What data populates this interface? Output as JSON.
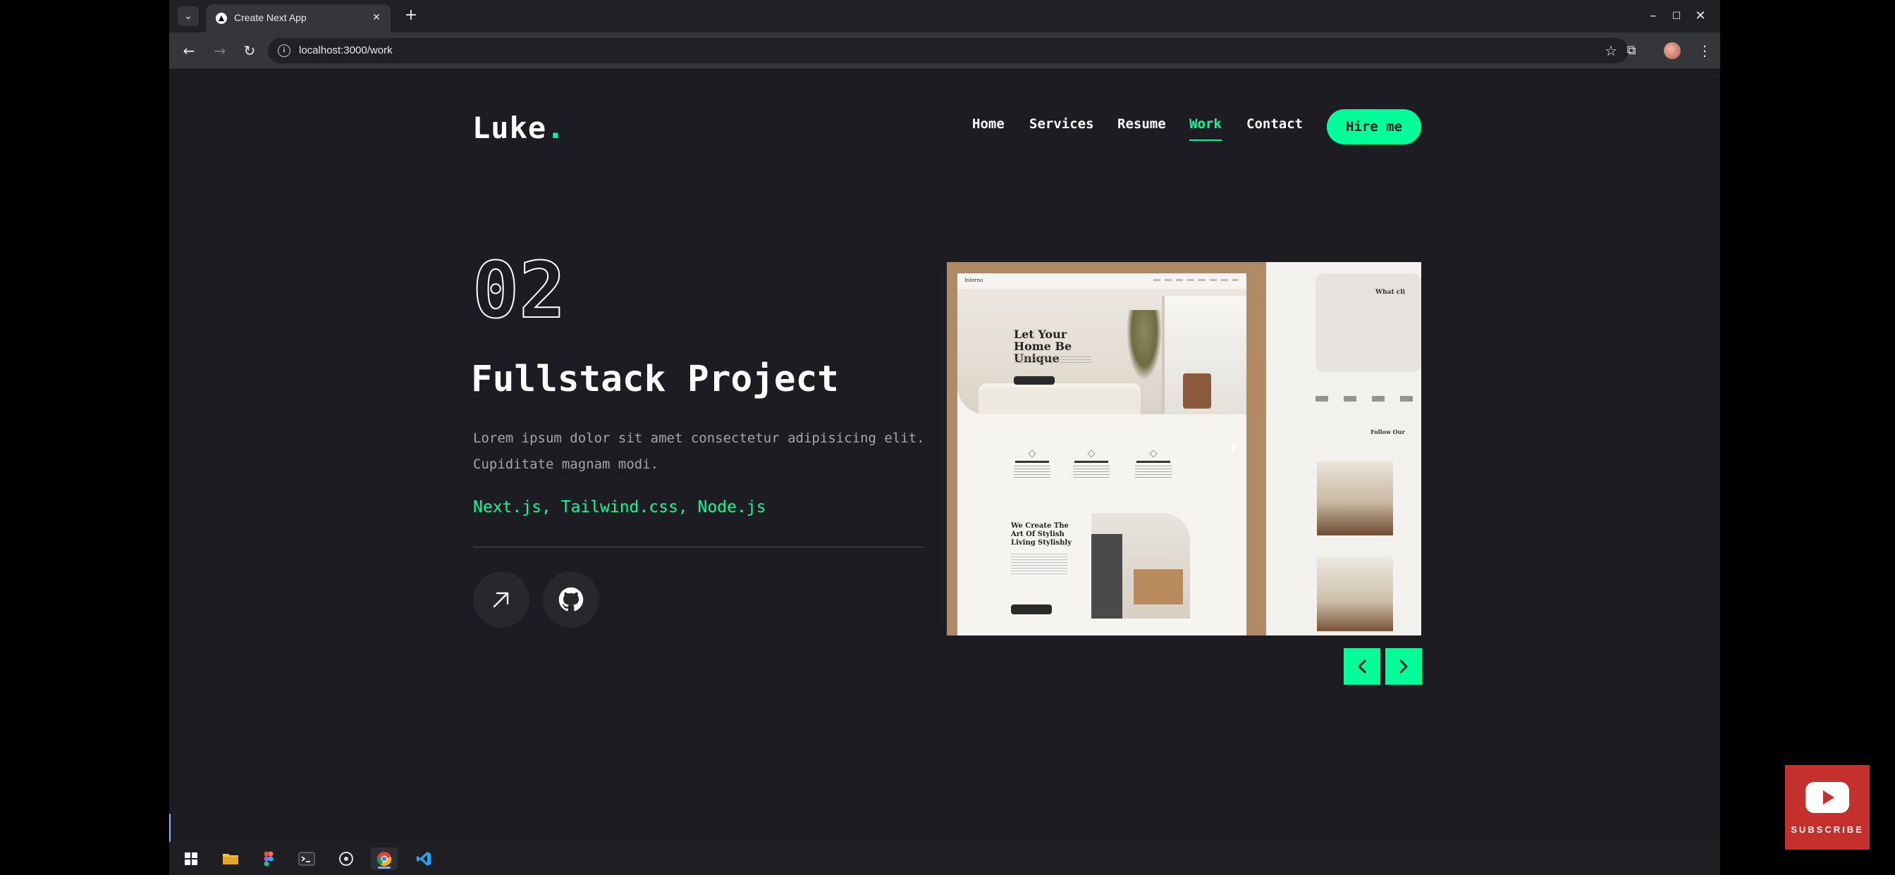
{
  "browser": {
    "tab_title": "Create Next App",
    "url": "localhost:3000/work"
  },
  "site": {
    "logo_text": "Luke",
    "logo_dot": ".",
    "nav": [
      {
        "label": "Home",
        "active": false
      },
      {
        "label": "Services",
        "active": false
      },
      {
        "label": "Resume",
        "active": false
      },
      {
        "label": "Work",
        "active": true
      },
      {
        "label": "Contact",
        "active": false
      }
    ],
    "hire_label": "Hire me",
    "accent_color": "#00ff99",
    "background_color": "#1c1c22"
  },
  "project": {
    "num": "02",
    "title": "Fullstack Project",
    "description": "Lorem ipsum dolor sit amet consectetur adipisicing elit. Cupiditate magnam modi.",
    "stack": "Next.js, Tailwind.css, Node.js",
    "live_icon": "arrow-up-right-icon",
    "github_icon": "github-icon"
  },
  "slide_preview": {
    "hero_title": "Let Your Home Be Unique",
    "brand": "Interno",
    "art_title": "We Create The Art Of Stylish Living Stylishly",
    "side_head": "What cli",
    "follow_text": "Follow Our"
  },
  "slider": {
    "prev_icon": "chevron-left-icon",
    "next_icon": "chevron-right-icon"
  },
  "overlay": {
    "subscribe_label": "SUBSCRIBE"
  }
}
